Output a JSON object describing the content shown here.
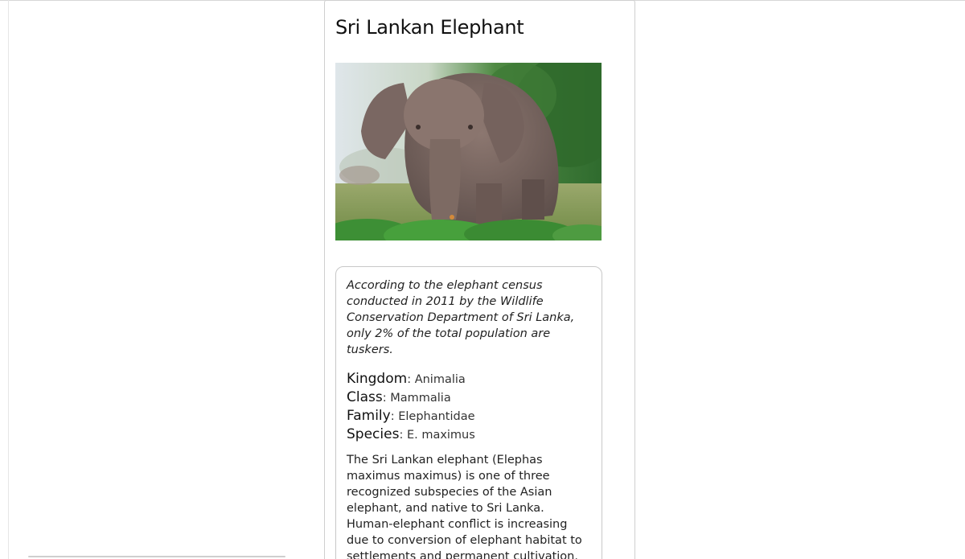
{
  "page": {
    "title": "Sri Lankan Elephant",
    "image": {
      "subject": "elephant-photo",
      "colors": {
        "sky": "#e3e8ec",
        "foliage": "#3f7d3a",
        "ground": "#8aa05a",
        "elephant": "#7d6a63"
      }
    }
  },
  "info": {
    "quote": "According to the elephant census conducted in 2011 by the Wildlife Conservation Department of Sri Lanka, only 2% of the total population are tuskers.",
    "taxonomy": [
      {
        "key": "Kingdom",
        "value": "Animalia"
      },
      {
        "key": "Class",
        "value": "Mammalia"
      },
      {
        "key": "Family",
        "value": "Elephantidae"
      },
      {
        "key": "Species",
        "value": "E. maximus"
      }
    ],
    "separator": ": ",
    "description": "The Sri Lankan elephant (Elephas maximus maximus) is one of three recognized subspecies of the Asian elephant, and native to Sri Lanka. Human-elephant conflict is increasing due to conversion of elephant habitat to settlements and permanent cultivation."
  }
}
